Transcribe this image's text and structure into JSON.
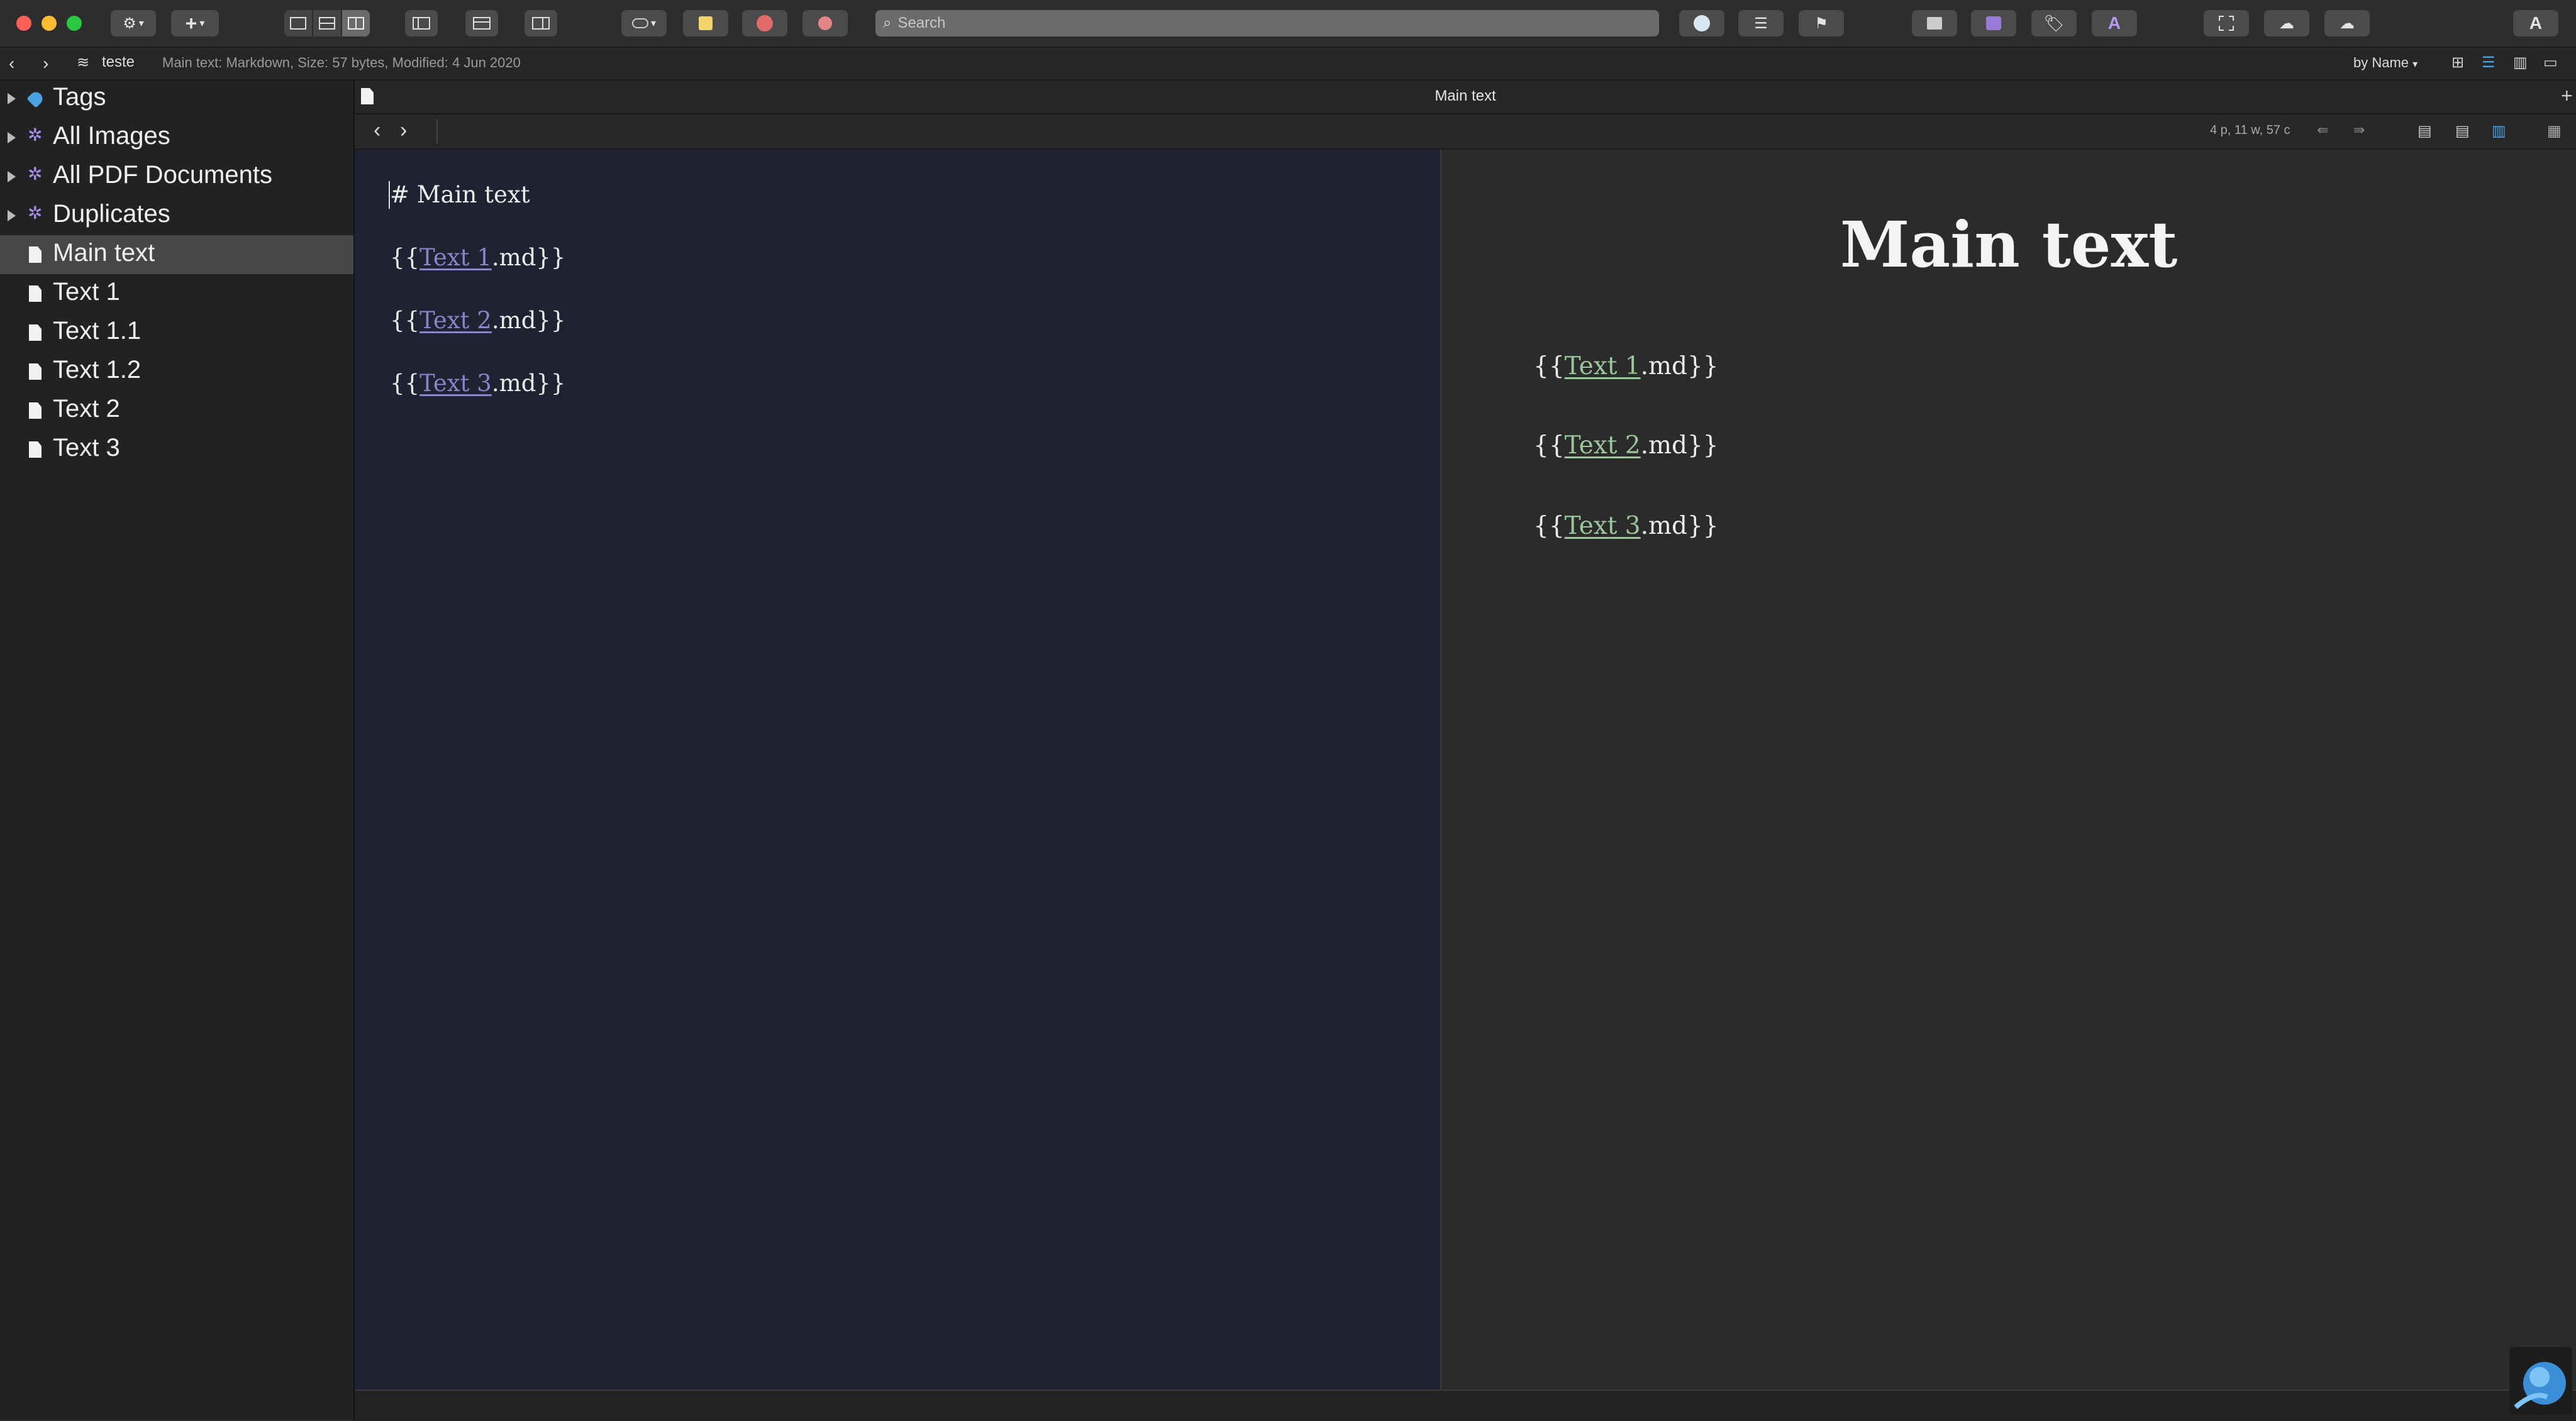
{
  "toolbar": {
    "search_placeholder": "Search",
    "colors": {
      "close": "#ff5f57",
      "minimize": "#febc2e",
      "zoom": "#28c840",
      "accent": "#5b9bd5"
    }
  },
  "pathbar": {
    "database_name": "teste",
    "info": "Main text: Markdown, Size: 57 bytes, Modified: 4 Jun 2020",
    "sort_label": "by Name"
  },
  "sidebar": {
    "items": [
      {
        "label": "Tags",
        "icon": "tag-icon"
      },
      {
        "label": "All Images",
        "icon": "smart-group-icon"
      },
      {
        "label": "All PDF Documents",
        "icon": "smart-group-icon"
      },
      {
        "label": "Duplicates",
        "icon": "smart-group-icon"
      },
      {
        "label": "Main text",
        "icon": "document-icon",
        "selected": true
      },
      {
        "label": "Text 1",
        "icon": "document-icon"
      },
      {
        "label": "Text 1.1",
        "icon": "document-icon"
      },
      {
        "label": "Text 1.2",
        "icon": "document-icon"
      },
      {
        "label": "Text 2",
        "icon": "document-icon"
      },
      {
        "label": "Text 3",
        "icon": "document-icon"
      }
    ]
  },
  "tab": {
    "title": "Main text"
  },
  "navbar": {
    "stats": "4 p, 11 w, 57 c"
  },
  "editor": {
    "heading": "# Main text",
    "lines": [
      {
        "prefix": "{{",
        "link": "Text 1",
        "suffix": ".md}}"
      },
      {
        "prefix": "{{",
        "link": "Text 2",
        "suffix": ".md}}"
      },
      {
        "prefix": "{{",
        "link": "Text 3",
        "suffix": ".md}}"
      }
    ]
  },
  "preview": {
    "title": "Main text",
    "lines": [
      {
        "prefix": "{{",
        "link": "Text 1",
        "suffix": ".md}}"
      },
      {
        "prefix": "{{",
        "link": "Text 2",
        "suffix": ".md}}"
      },
      {
        "prefix": "{{",
        "link": "Text 3",
        "suffix": ".md}}"
      }
    ]
  }
}
